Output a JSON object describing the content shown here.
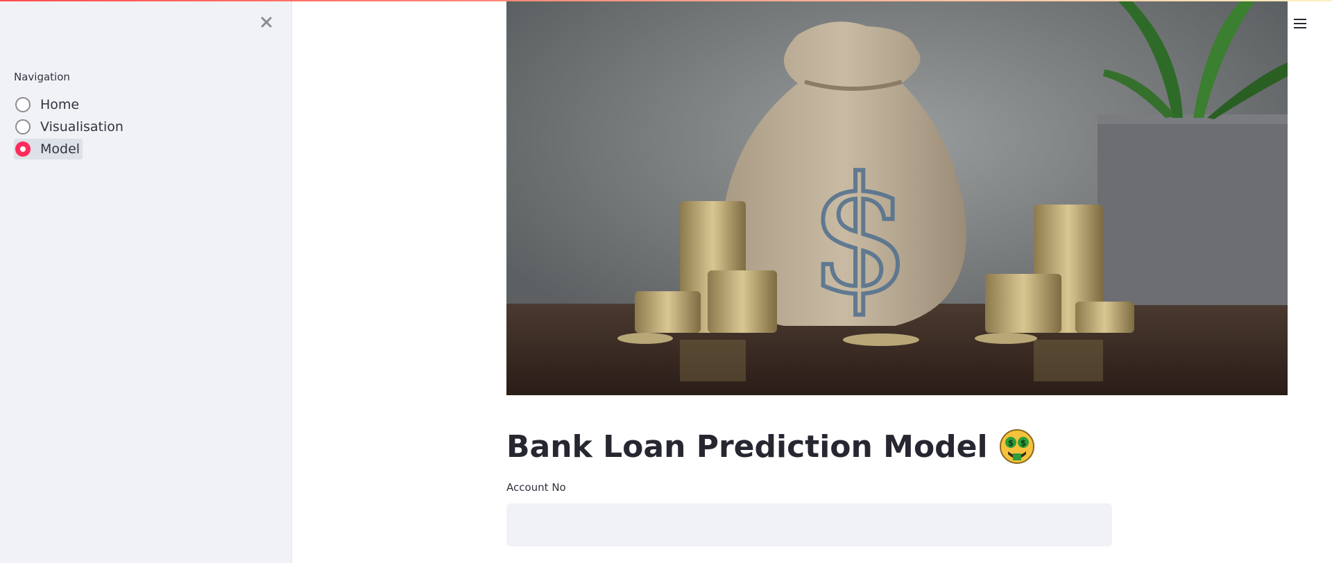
{
  "sidebar": {
    "close_icon": "close-icon",
    "nav_label": "Navigation",
    "items": [
      {
        "label": "Home",
        "selected": false
      },
      {
        "label": "Visualisation",
        "selected": false
      },
      {
        "label": "Model",
        "selected": true
      }
    ],
    "accent_color": "#ff2b5b"
  },
  "header": {
    "menu_icon": "hamburger-menu-icon"
  },
  "main": {
    "hero_image_icon": "money-bag-coins-image",
    "title": "Bank Loan Prediction Model",
    "title_emoji": "money-mouth-face",
    "account_field": {
      "label": "Account No",
      "value": "",
      "placeholder": ""
    }
  }
}
